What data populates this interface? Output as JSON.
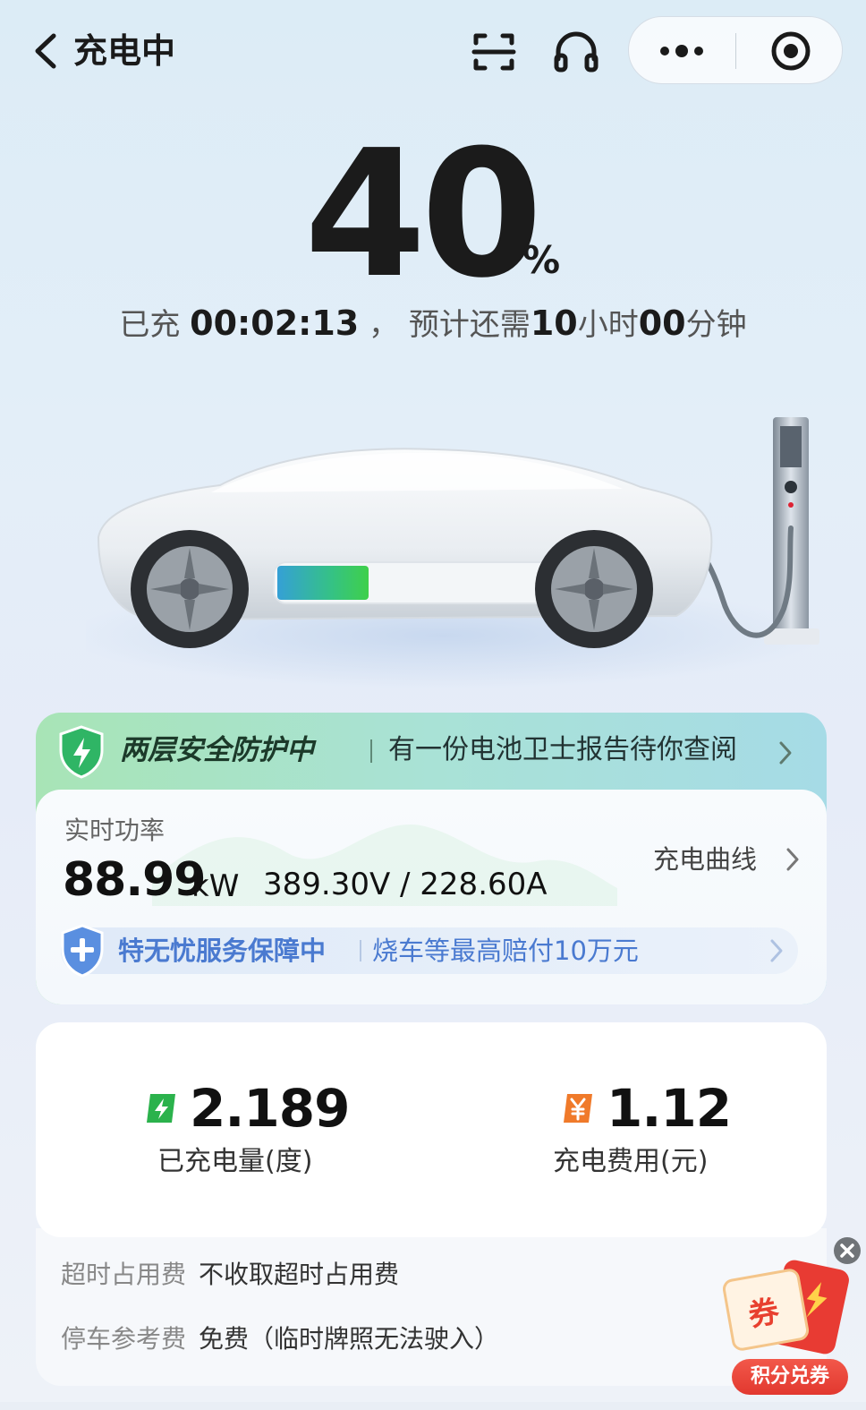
{
  "header": {
    "title": "充电中",
    "icons": [
      "back-arrow-icon",
      "scan-icon",
      "headset-icon",
      "more-dots-icon",
      "record-icon"
    ]
  },
  "charge": {
    "percent": "40",
    "percent_sign": "%",
    "level_fraction": 0.4,
    "elapsed_label": "已充",
    "elapsed_time": "00:02:13",
    "separator": "，",
    "remaining_label": "预计还需",
    "remaining_hours": "10",
    "hours_unit": "小时",
    "remaining_minutes": "00",
    "minutes_unit": "分钟"
  },
  "safety": {
    "title": "两层安全防护中",
    "text": "有一份电池卫士报告待你查阅"
  },
  "power": {
    "label": "实时功率",
    "value": "88.99",
    "unit": "kW",
    "voltage_current": "389.30V / 228.60A",
    "curve_link": "充电曲线"
  },
  "guarantee": {
    "title": "特无忧服务保障中",
    "text": "烧车等最高赔付10万元"
  },
  "stats": {
    "energy_value": "2.189",
    "energy_label": "已充电量(度)",
    "fee_value": "1.12",
    "fee_label": "充电费用(元)"
  },
  "fees": {
    "overtime_key": "超时占用费",
    "overtime_val": "不收取超时占用费",
    "parking_key": "停车参考费",
    "parking_val": "免费（临时牌照无法驶入）"
  },
  "coupon": {
    "badge": "券",
    "label": "积分兑券"
  },
  "colors": {
    "safety_green": "#a8e4b6",
    "guarantee_blue": "#4a7ad0",
    "energy_green": "#2bb24c",
    "fee_orange": "#f07a2a",
    "coupon_red": "#e2382f"
  }
}
